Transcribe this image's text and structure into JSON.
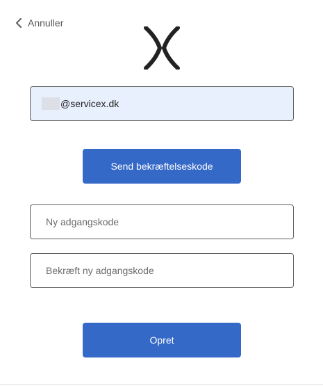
{
  "header": {
    "cancel_label": "Annuller"
  },
  "logo": {
    "icon": "x-logo-icon",
    "color": "#222222"
  },
  "form": {
    "email_value_suffix": "@servicex.dk",
    "send_code_label": "Send bekræftelseskode",
    "new_password_placeholder": "Ny adgangskode",
    "confirm_password_placeholder": "Bekræft ny adgangskode",
    "create_label": "Opret"
  },
  "colors": {
    "primary_button": "#3569c7",
    "autofill_background": "#e8f0fe"
  }
}
